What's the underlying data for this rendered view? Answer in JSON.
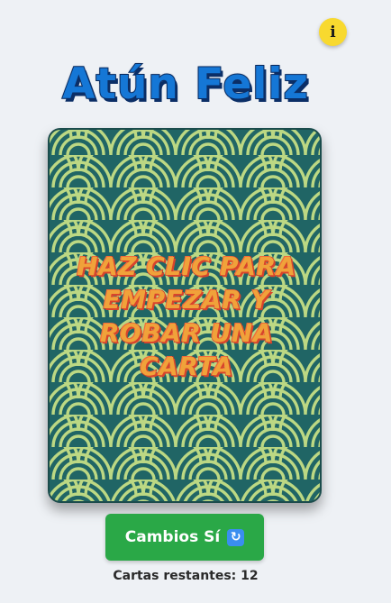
{
  "info_button": {
    "label": "i"
  },
  "title": "Atún Feliz",
  "card": {
    "prompt": "Haz clic para empezar y robar una carta"
  },
  "swap_button": {
    "label": "Cambios Sí",
    "icon": "refresh-icon"
  },
  "remaining": {
    "label": "Cartas restantes:",
    "count": "12"
  },
  "colors": {
    "background": "#eef1f5",
    "title_fill": "#1577d6",
    "card_bg": "#236b6b",
    "card_wave": "#d4ee8e",
    "card_text": "#f0a23a",
    "button_green": "#2aa847",
    "info_yellow": "#f8d92f"
  }
}
